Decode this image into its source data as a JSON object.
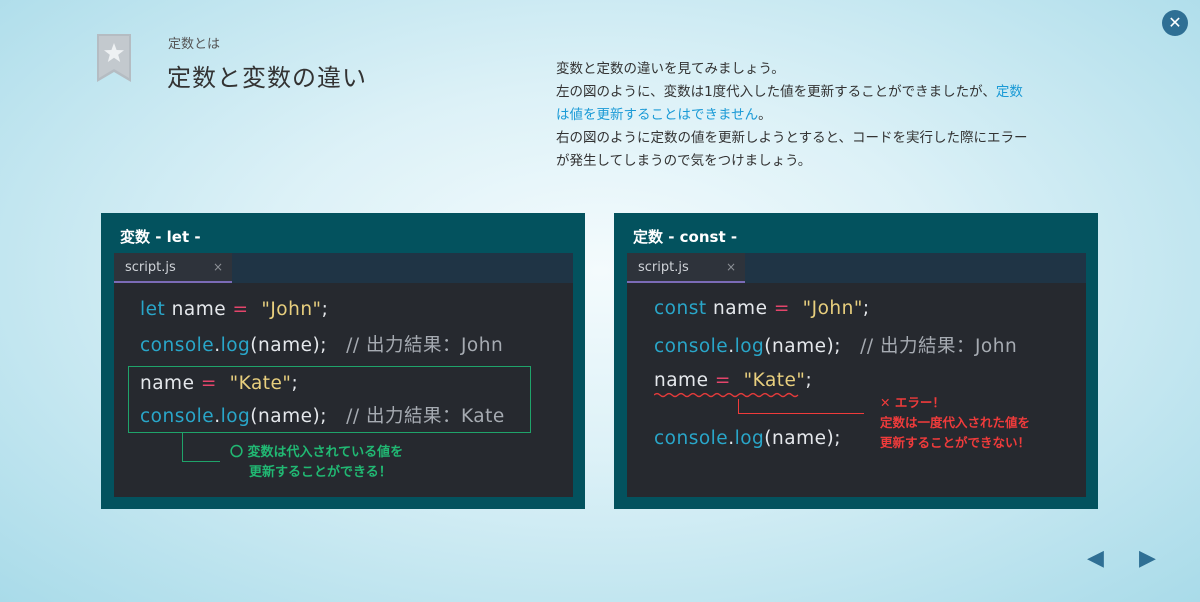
{
  "header": {
    "section": "定数とは",
    "title": "定数と変数の違い"
  },
  "description": {
    "line1": "変数と定数の違いを見てみましょう。",
    "line2a": "左の図のように、変数は1度代入した値を更新することができましたが、",
    "line2b": "定数",
    "line3a": "は値を更新することはできません",
    "line3b": "。",
    "line4": "右の図のように定数の値を更新しようとすると、コードを実行した際にエラー",
    "line5": "が発生してしまうので気をつけましょう。"
  },
  "left_panel": {
    "title": "変数  - let -",
    "tab": "script.js",
    "tab_close": "×",
    "code": {
      "l1_kw": "let",
      "l1_var": "name",
      "l1_op": "=",
      "l1_str": "\"John\"",
      "l1_end": ";",
      "l2_obj": "console",
      "l2_dot": ".",
      "l2_fn": "log",
      "l2_args": "(name);",
      "l2_comment": "// 出力結果：John",
      "l3_var": "name",
      "l3_op": "=",
      "l3_str": "\"Kate\"",
      "l3_end": ";",
      "l4_obj": "console",
      "l4_dot": ".",
      "l4_fn": "log",
      "l4_args": "(name);",
      "l4_comment": "// 出力結果：Kate"
    },
    "note_line1": "〇 変数は代入されている値を",
    "note_line2": "更新することができる！"
  },
  "right_panel": {
    "title": "定数  - const -",
    "tab": "script.js",
    "tab_close": "×",
    "code": {
      "l1_kw": "const",
      "l1_var": "name",
      "l1_op": "=",
      "l1_str": "\"John\"",
      "l1_end": ";",
      "l2_obj": "console",
      "l2_dot": ".",
      "l2_fn": "log",
      "l2_args": "(name);",
      "l2_comment": "// 出力結果：John",
      "l3_var": "name",
      "l3_op": "=",
      "l3_str": "\"Kate\"",
      "l3_end": ";",
      "l4_obj": "console",
      "l4_dot": ".",
      "l4_fn": "log",
      "l4_args": "(name);"
    },
    "error_line1": "✕ エラー！",
    "error_line2": "定数は一度代入された値を",
    "error_line3": "更新することができない！"
  },
  "controls": {
    "close": "✕",
    "prev": "◀",
    "next": "▶"
  }
}
